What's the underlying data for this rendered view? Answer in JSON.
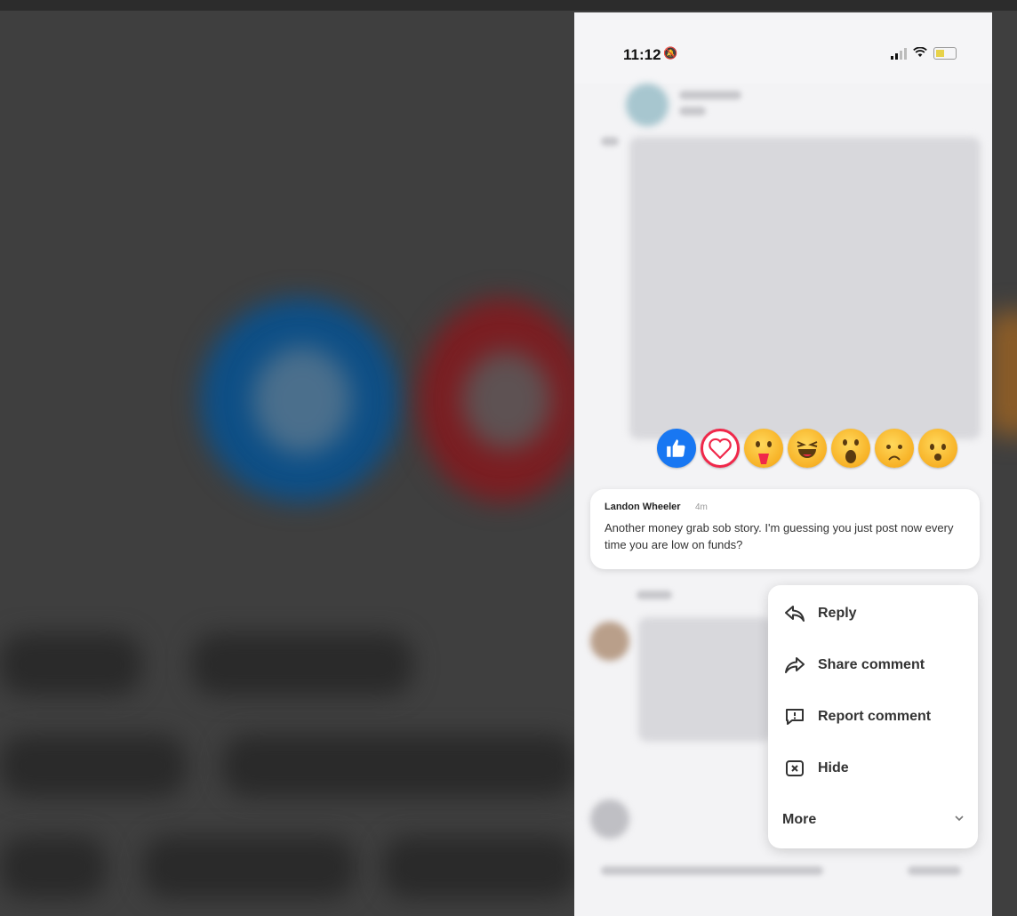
{
  "status_bar": {
    "time": "11:12",
    "bell_icon": "bell-slash-icon",
    "signal_icon": "cellular-signal-icon",
    "wifi_icon": "wifi-icon",
    "battery_icon": "battery-icon"
  },
  "reactions": [
    {
      "name": "like",
      "icon": "like-reaction-icon",
      "color": "#1877f2"
    },
    {
      "name": "love",
      "icon": "love-reaction-icon",
      "color": "#f0284a"
    },
    {
      "name": "care",
      "icon": "care-reaction-icon",
      "color": "#f7b125"
    },
    {
      "name": "haha",
      "icon": "haha-reaction-icon",
      "color": "#f7b125"
    },
    {
      "name": "wow",
      "icon": "wow-reaction-icon",
      "color": "#f7b125"
    },
    {
      "name": "sad",
      "icon": "sad-reaction-icon",
      "color": "#f7b125"
    },
    {
      "name": "angry",
      "icon": "angry-reaction-icon",
      "color": "#f7b125"
    }
  ],
  "comment": {
    "author": "Landon Wheeler",
    "time": "4m",
    "text": "Another money grab sob story. I'm guessing you just post now every time you are low on funds?"
  },
  "menu": {
    "items": [
      {
        "label": "Reply",
        "icon": "reply-icon"
      },
      {
        "label": "Share comment",
        "icon": "share-icon"
      },
      {
        "label": "Report comment",
        "icon": "report-icon"
      },
      {
        "label": "Hide",
        "icon": "hide-icon"
      },
      {
        "label": "More",
        "icon": "chevron-down-icon"
      }
    ]
  },
  "colors": {
    "facebook_blue": "#1877f2",
    "love_red": "#f0284a",
    "emoji_yellow": "#f7b125"
  }
}
